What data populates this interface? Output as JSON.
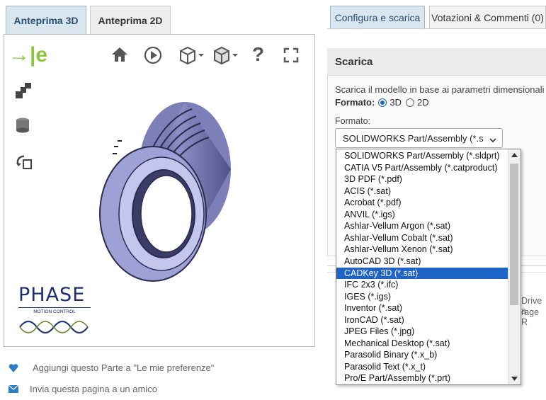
{
  "left_tabs": {
    "tab_3d": "Anteprima 3D",
    "tab_2d": "Anteprima 2D"
  },
  "viewer": {
    "logo_text": "→|e",
    "brand": {
      "name": "PHASE",
      "sub": "MOTION CONTROL"
    }
  },
  "icons": [
    "home-icon",
    "play-icon",
    "view-cube-icon",
    "box-view-icon",
    "help-icon",
    "fullscreen-icon",
    "explode-icon",
    "section-icon",
    "rotate-icon"
  ],
  "right_tabs": {
    "configure": "Configura e scarica",
    "ratings": "Votazioni & Commenti (0)"
  },
  "download": {
    "title": "Scarica",
    "description": "Scarica il modello in base ai parametri dimensionali",
    "format_label": "Formato:",
    "radio_3d": "3D",
    "radio_2d": "2D",
    "format_select_label": "Formato:",
    "selected_value": "SOLIDWORKS Part/Assembly (*.s",
    "side_text_1": "Drive a",
    "side_text_2": "rage R"
  },
  "format_options": [
    "SOLIDWORKS Part/Assembly (*.sldprt)",
    "CATIA V5 Part/Assembly (*.catproduct)",
    "3D PDF (*.pdf)",
    "ACIS (*.sat)",
    "Acrobat (*.pdf)",
    "ANVIL (*.igs)",
    "Ashlar-Vellum Argon (*.sat)",
    "Ashlar-Vellum Cobalt (*.sat)",
    "Ashlar-Vellum Xenon (*.sat)",
    "AutoCAD 3D (*.sat)",
    "CADKey 3D (*.sat)",
    "IFC 2x3 (*.ifc)",
    "IGES (*.igs)",
    "Inventor (*.sat)",
    "IronCAD (*.sat)",
    "JPEG Files (*.jpg)",
    "Mechanical Desktop (*.sat)",
    "Parasolid Binary (*.x_b)",
    "Parasolid Text (*.x_t)",
    "Pro/E Part/Assembly (*.prt)"
  ],
  "highlighted_option": "CADKey 3D (*.sat)",
  "links": {
    "favorites": "Aggiungi questo Parte a \"Le mie preferenze\"",
    "email": "Invia questa pagina a un amico"
  },
  "colors": {
    "accent": "#1e64c8",
    "logo_green": "#8cc63f",
    "tab_active": "#d9e6ef"
  }
}
